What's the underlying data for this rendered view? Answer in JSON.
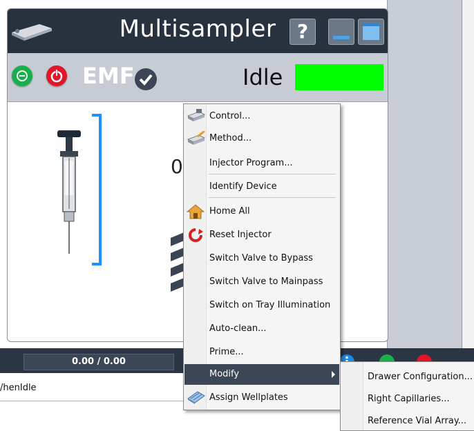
{
  "module": {
    "title": "Multisampler",
    "emf_label": "EMF",
    "status_text": "Idle",
    "status_color": "#00ff00",
    "partial_text": "0"
  },
  "title_buttons": {
    "help_glyph": "?"
  },
  "bottom": {
    "progress_text": "0.00 / 0.00",
    "line_text": "/henIdle"
  },
  "context_menu": {
    "items": [
      {
        "label": "Control...",
        "icon": "control-icon"
      },
      {
        "label": "Method...",
        "icon": "method-icon"
      },
      {
        "label": "Injector Program...",
        "icon": ""
      },
      {
        "label": "Identify Device",
        "icon": ""
      },
      {
        "label": "Home All",
        "icon": "home-icon"
      },
      {
        "label": "Reset Injector",
        "icon": "reset-icon"
      },
      {
        "label": "Switch Valve to Bypass",
        "icon": ""
      },
      {
        "label": "Switch Valve to Mainpass",
        "icon": ""
      },
      {
        "label": "Switch on Tray Illumination",
        "icon": ""
      },
      {
        "label": "Auto-clean...",
        "icon": ""
      },
      {
        "label": "Prime...",
        "icon": ""
      },
      {
        "label": "Modify",
        "icon": "",
        "highlighted": true,
        "has_submenu": true
      },
      {
        "label": "Assign Wellplates",
        "icon": "wellplate-icon"
      }
    ]
  },
  "submenu": {
    "items": [
      {
        "label": "Drawer Configuration..."
      },
      {
        "label": "Right Capillaries..."
      },
      {
        "label": "Reference Vial Array..."
      }
    ]
  },
  "colors": {
    "title_bar": "#28323f",
    "status_bar": "#c6cbd4",
    "menu_highlight": "#3c4656",
    "capillary_blue": "#1e90ff"
  }
}
